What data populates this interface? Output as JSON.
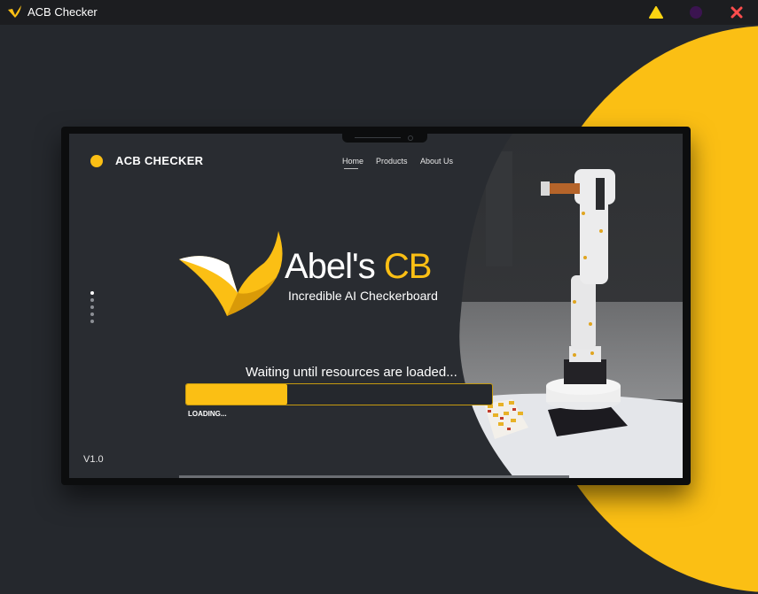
{
  "window": {
    "title": "ACB Checker",
    "controls": [
      "minimize",
      "maximize",
      "close"
    ]
  },
  "colors": {
    "accent": "#fbbf14",
    "background": "#25282d",
    "titlebar": "#1c1d20",
    "purple_button": "#3b1450",
    "close": "#ff4d4d"
  },
  "site": {
    "brand": "ACB CHECKER",
    "nav": [
      "Home",
      "Products",
      "About Us"
    ],
    "active_nav": "Home",
    "slide_count": 5,
    "active_slide": 1
  },
  "hero": {
    "title_main": "Abel's ",
    "title_accent": "CB",
    "subtitle": "Incredible AI Checkerboard"
  },
  "loader": {
    "message": "Waiting until resources are loaded...",
    "progress_percent": 33,
    "label": "LOADING..."
  },
  "version": "V1.0",
  "icons": {
    "app": "chevron-logo-icon",
    "minimize": "triangle-icon",
    "maximize": "circle-icon",
    "close": "x-icon"
  }
}
